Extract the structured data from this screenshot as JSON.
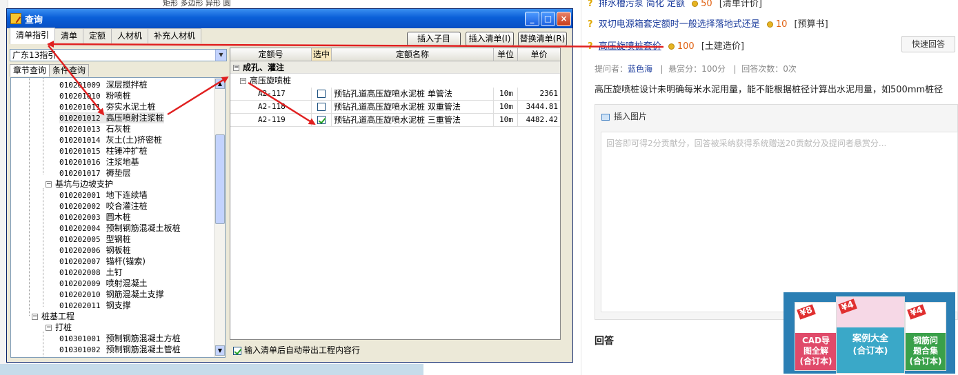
{
  "background": {
    "questions": [
      {
        "title": "排水槽污泵 简化 定额",
        "points": "50",
        "category": "[清单计价]"
      },
      {
        "title": "双切电源箱套定额时一般选择落地式还是",
        "points": "10",
        "category": "[预算书]"
      },
      {
        "title": "高压旋喷桩套价",
        "points": "100",
        "category": "[土建造价]"
      }
    ],
    "quick_answer": "快速回答",
    "meta": {
      "asker_label": "提问者：",
      "asker": "蓝色海",
      "reward": "悬赏分：100分",
      "answers": "回答次数：0次"
    },
    "question_text": "高压旋喷桩设计未明确每米水泥用量，能不能根据桩径计算出水泥用量，如500mm桩径",
    "insert_image": "插入图片",
    "placeholder": "回答即可得2分贡献分，回答被采纳获得系统赠送20贡献分及提问者悬赏分...",
    "answer_title": "回答",
    "ad": {
      "books": [
        {
          "badge": "¥8",
          "line1": "CAD导",
          "line2": "图全解",
          "line3": "(合订本)"
        },
        {
          "badge": "¥4",
          "line1": "案例大全",
          "line2": "(合订本)",
          "line3": ""
        },
        {
          "badge": "¥4",
          "line1": "钢筋问",
          "line2": "题合集",
          "line3": "(合订本)"
        }
      ]
    },
    "header_fragment": "矩形  多边形  异形  圆"
  },
  "dialog": {
    "title": "查询",
    "window_buttons": [
      "_",
      "□",
      "×"
    ],
    "tabs": [
      "清单指引",
      "清单",
      "定额",
      "人材机",
      "补充人材机"
    ],
    "buttons": {
      "insert_child": "插入子目",
      "insert_list": "插入清单(I)",
      "replace_list": "替换清单(R)"
    },
    "region": "广东13指引",
    "subtabs": [
      "章节查询",
      "条件查询"
    ],
    "tree": [
      {
        "code": "010201009",
        "name": "深层搅拌桩"
      },
      {
        "code": "010201010",
        "name": "粉喷桩"
      },
      {
        "code": "010201011",
        "name": "夯实水泥土桩"
      },
      {
        "code": "010201012",
        "name": "高压喷射注浆桩",
        "selected": true
      },
      {
        "code": "010201013",
        "name": "石灰桩"
      },
      {
        "code": "010201014",
        "name": "灰土(土)挤密桩"
      },
      {
        "code": "010201015",
        "name": "柱锤冲扩桩"
      },
      {
        "code": "010201016",
        "name": "注浆地基"
      },
      {
        "code": "010201017",
        "name": "褥垫层"
      },
      {
        "group": "基坑与边坡支护",
        "level": 1
      },
      {
        "code": "010202001",
        "name": "地下连续墙"
      },
      {
        "code": "010202002",
        "name": "咬合灌注桩"
      },
      {
        "code": "010202003",
        "name": "圆木桩"
      },
      {
        "code": "010202004",
        "name": "预制钢筋混凝土板桩"
      },
      {
        "code": "010202005",
        "name": "型钢桩"
      },
      {
        "code": "010202006",
        "name": "钢板桩"
      },
      {
        "code": "010202007",
        "name": "锚杆(锚索)"
      },
      {
        "code": "010202008",
        "name": "土钉"
      },
      {
        "code": "010202009",
        "name": "喷射混凝土"
      },
      {
        "code": "010202010",
        "name": "钢筋混凝土支撑"
      },
      {
        "code": "010202011",
        "name": "钢支撑"
      },
      {
        "group": "桩基工程",
        "level": 0
      },
      {
        "group": "打桩",
        "level": 1
      },
      {
        "code": "010301001",
        "name": "预制钢筋混凝土方桩"
      },
      {
        "code": "010301002",
        "name": "预制钢筋混凝土管桩"
      }
    ],
    "grid": {
      "headers": [
        "定额号",
        "选中",
        "定额名称",
        "单位",
        "单价"
      ],
      "category": "成孔、灌注",
      "subcategory": "高压旋喷桩",
      "rows": [
        {
          "code": "A2-117",
          "checked": false,
          "name": "预钻孔道高压旋喷水泥桩 单管法",
          "unit": "10m",
          "price": "2361"
        },
        {
          "code": "A2-118",
          "checked": false,
          "name": "预钻孔道高压旋喷水泥桩 双重管法",
          "unit": "10m",
          "price": "3444.81"
        },
        {
          "code": "A2-119",
          "checked": true,
          "name": "预钻孔道高压旋喷水泥桩 三重管法",
          "unit": "10m",
          "price": "4482.42"
        }
      ]
    },
    "bottom_checkbox": "输入清单后自动带出工程内容行"
  },
  "colors": {
    "annotation_arrow": "#e02020",
    "link": "#1a3b9c",
    "titlebar": "#0a5fd8"
  }
}
